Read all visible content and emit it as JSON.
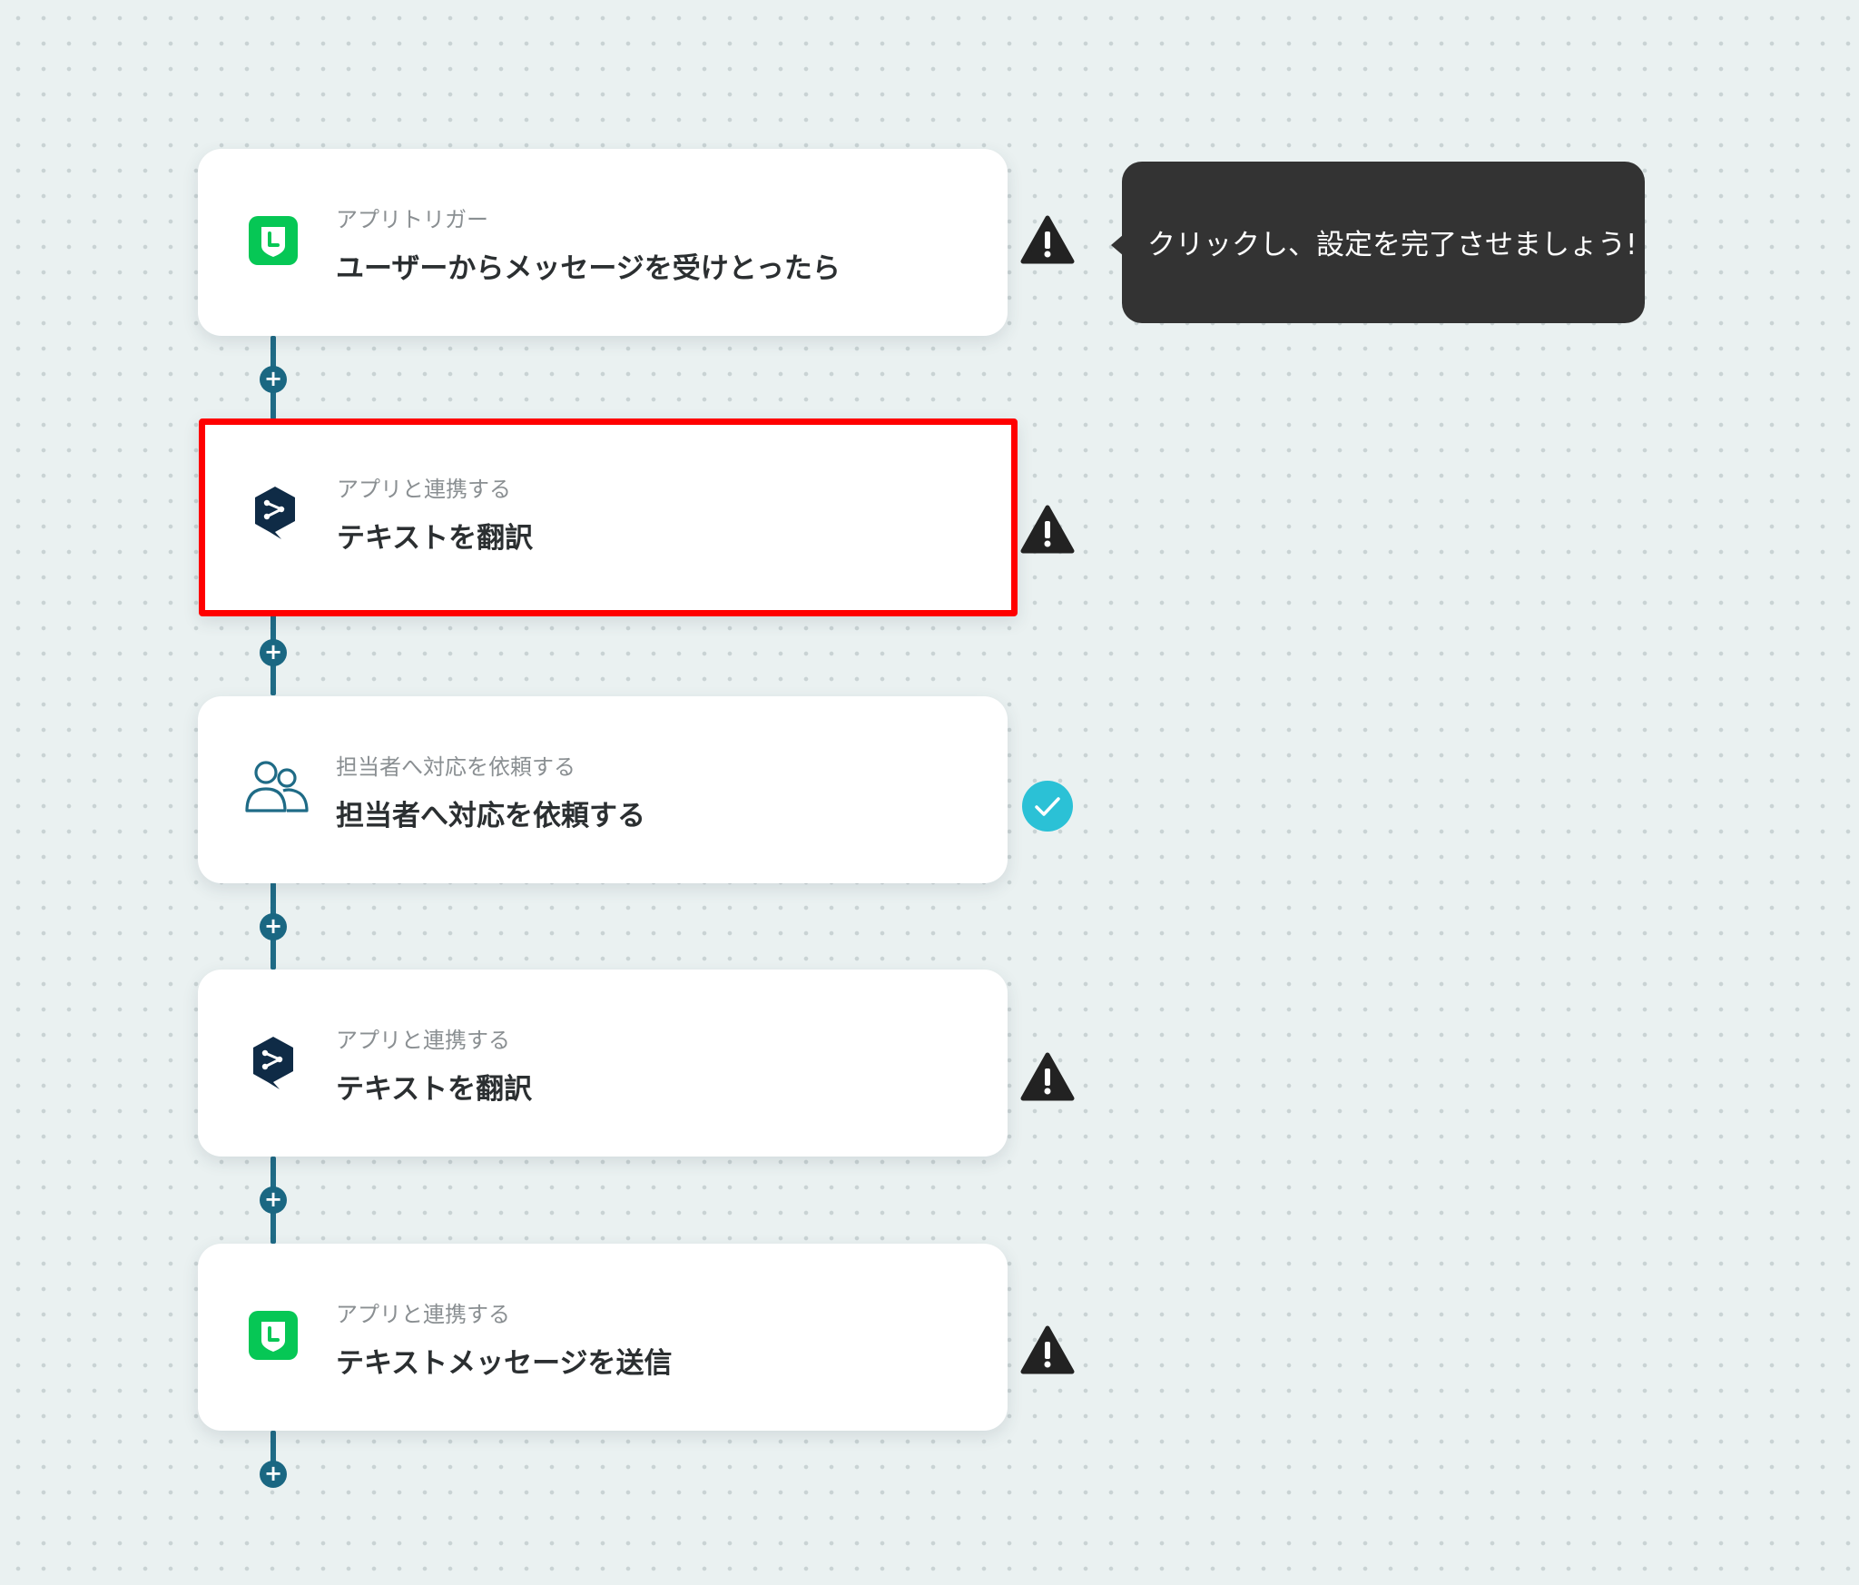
{
  "colors": {
    "background": "#eaf1f1",
    "connector": "#1f6b86",
    "line_brand": "#06c755",
    "deepl_brand": "#0f2b46",
    "selection_border": "#ff0000",
    "warning": "#222222",
    "success": "#2bc1d6",
    "tooltip_bg": "#333333"
  },
  "tooltip": {
    "text": "クリックし、設定を完了させましょう!"
  },
  "add_button_icon": "plus-icon",
  "steps": [
    {
      "category": "アプリトリガー",
      "title": "ユーザーからメッセージを受けとったら",
      "icon": "line-app-icon",
      "status": "warning-icon"
    },
    {
      "category": "アプリと連携する",
      "title": "テキストを翻訳",
      "icon": "deepl-app-icon",
      "status": "warning-icon",
      "selected": true
    },
    {
      "category": "担当者へ対応を依頼する",
      "title": "担当者へ対応を依頼する",
      "icon": "users-icon",
      "status": "check-icon"
    },
    {
      "category": "アプリと連携する",
      "title": "テキストを翻訳",
      "icon": "deepl-app-icon",
      "status": "warning-icon"
    },
    {
      "category": "アプリと連携する",
      "title": "テキストメッセージを送信",
      "icon": "line-app-icon",
      "status": "warning-icon"
    }
  ]
}
